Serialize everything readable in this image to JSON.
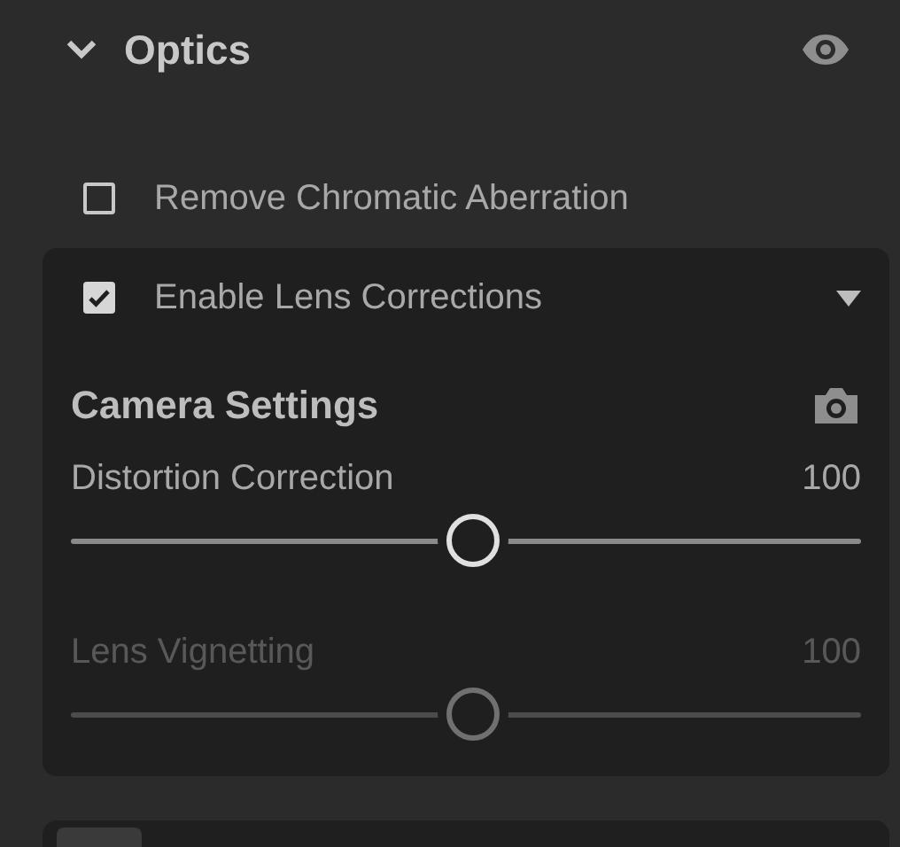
{
  "section": {
    "title": "Optics",
    "expanded": true
  },
  "options": [
    {
      "label": "Remove Chromatic Aberration",
      "checked": false
    }
  ],
  "lens_panel": {
    "checkbox": {
      "label": "Enable Lens Corrections",
      "checked": true
    },
    "heading": "Camera Settings",
    "sliders": [
      {
        "label": "Distortion Correction",
        "reading": "100",
        "level": 0.51,
        "disabled": false
      },
      {
        "label": "Lens Vignetting",
        "reading": "100",
        "level": 0.51,
        "disabled": true
      }
    ]
  }
}
